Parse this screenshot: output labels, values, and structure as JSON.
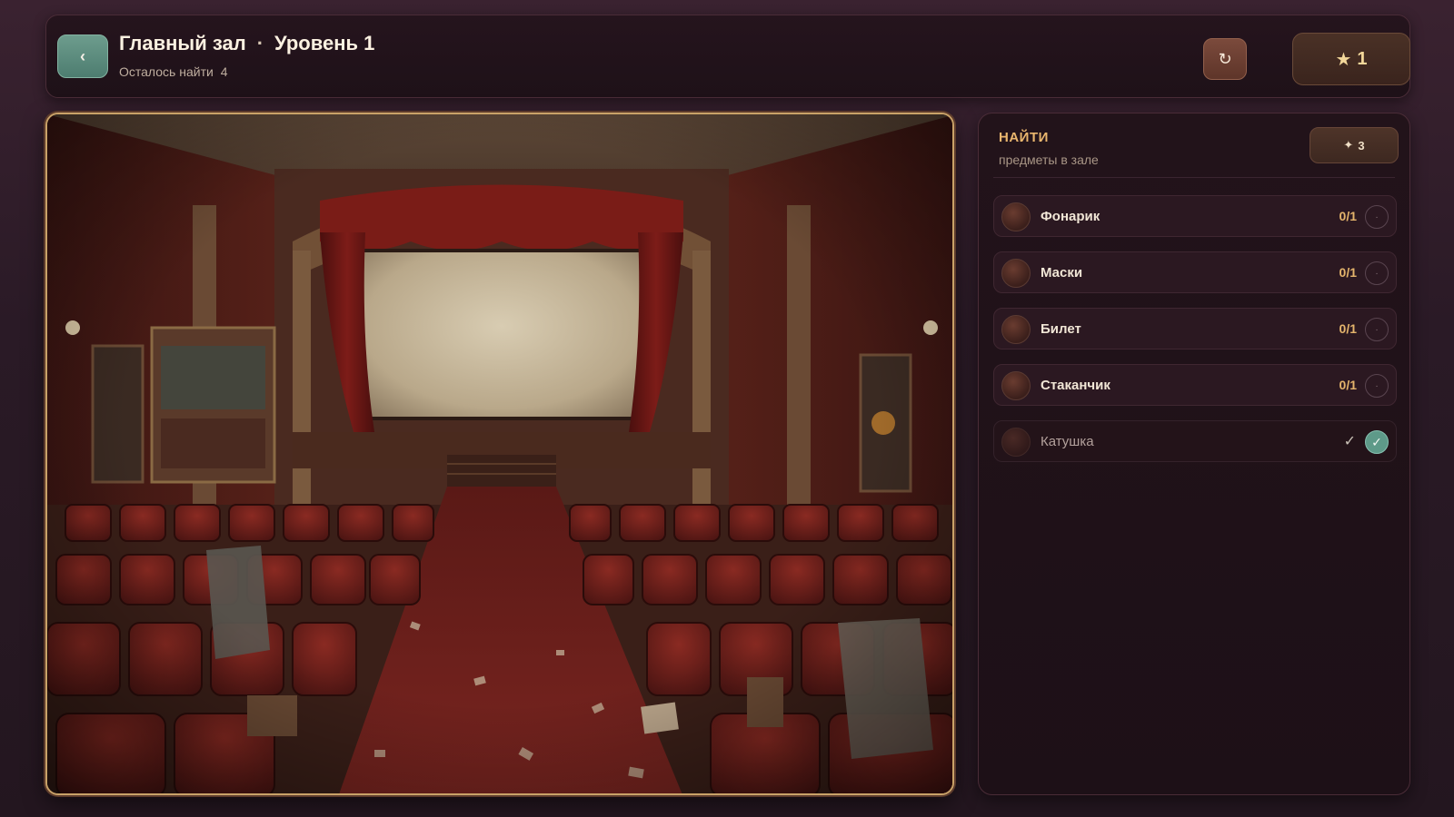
{
  "header": {
    "back_icon": "‹",
    "location": "Главный зал",
    "separator": "·",
    "level": "Уровень 1",
    "remaining_label": "Осталось найти",
    "remaining_count": "4",
    "reset_icon": "↻",
    "score_icon": "★",
    "score_value": "1"
  },
  "panel": {
    "title": "НАЙТИ",
    "subtitle": "предметы в зале",
    "hint_icon": "✦",
    "hint_count": "3",
    "items": [
      {
        "name": "Фонарик",
        "progress": "0/1",
        "state": "·",
        "found": false,
        "icon": "flashlight-icon"
      },
      {
        "name": "Маски",
        "progress": "0/1",
        "state": "·",
        "found": false,
        "icon": "masks-icon"
      },
      {
        "name": "Билет",
        "progress": "0/1",
        "state": "·",
        "found": false,
        "icon": "ticket-icon"
      },
      {
        "name": "Стаканчик",
        "progress": "0/1",
        "state": "·",
        "found": false,
        "icon": "cup-icon"
      },
      {
        "name": "Катушка",
        "progress": "✓",
        "state": "✓",
        "found": true,
        "icon": "film-reel-icon"
      }
    ]
  },
  "colors": {
    "accent_gold": "#e4b46c",
    "found_teal": "#5e9a89",
    "back_button": "#5e8e80",
    "frame_gold": "#c9a268"
  }
}
